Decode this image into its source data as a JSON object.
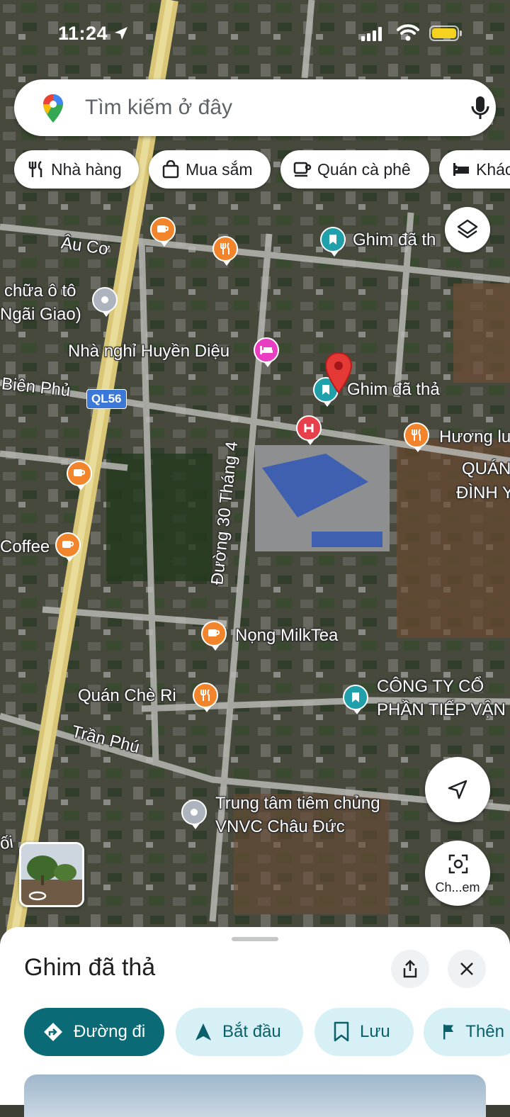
{
  "status_bar": {
    "time": "11:24"
  },
  "search": {
    "placeholder": "Tìm kiếm ở đây"
  },
  "chips": [
    {
      "label": "Nhà hàng",
      "icon": "fork-knife-icon"
    },
    {
      "label": "Mua sắm",
      "icon": "shopping-bag-icon"
    },
    {
      "label": "Quán cà phê",
      "icon": "coffee-cup-icon"
    },
    {
      "label": "Khác",
      "icon": "bed-icon"
    }
  ],
  "map": {
    "roads": {
      "au_co": "Âu Cơ",
      "bien_phu": "Biên Phủ",
      "ql56": "QL56",
      "duong_30_thang_4": "Đường 30 Tháng 4",
      "tran_phu": "Trần Phú",
      "edge_left": "ối"
    },
    "places": {
      "ghim_top": "Ghim đã th",
      "sua_chua_line1": "chữa ô tô",
      "sua_chua_line2": "Ngãi Giao)",
      "nha_nghi": "Nhà nghỉ Huyền Diệu",
      "ghim_dropped": "Ghim đã thả",
      "huong": "Hương lu",
      "quan_line1": "QUÁN",
      "quan_line2": "ĐÌNH Y",
      "coffee": "Coffee",
      "milktea": "Nọng MilkTea",
      "che_ri": "Quán Chè Ri",
      "cong_ty_line1": "CÔNG TY CỔ",
      "cong_ty_line2": "PHẦN TIẾP VẬN",
      "vnvc_line1": "Trung tâm tiêm chủng",
      "vnvc_line2": "VNVC Châu Đức"
    }
  },
  "lens_button": {
    "label": "Ch...em"
  },
  "sheet": {
    "title": "Ghim đã thả",
    "actions": [
      {
        "label": "Đường đi",
        "icon": "directions-icon"
      },
      {
        "label": "Bắt đầu",
        "icon": "navigation-arrow-icon"
      },
      {
        "label": "Lưu",
        "icon": "bookmark-icon"
      },
      {
        "label": "Thên",
        "icon": "flag-icon"
      }
    ]
  },
  "colors": {
    "primary": "#0a6b77",
    "secondary_bg": "#d6f0f5",
    "pin_red": "#e53935",
    "pin_orange": "#f2852b",
    "pin_teal": "#1fa0aa",
    "pin_pink": "#e93ec2"
  }
}
